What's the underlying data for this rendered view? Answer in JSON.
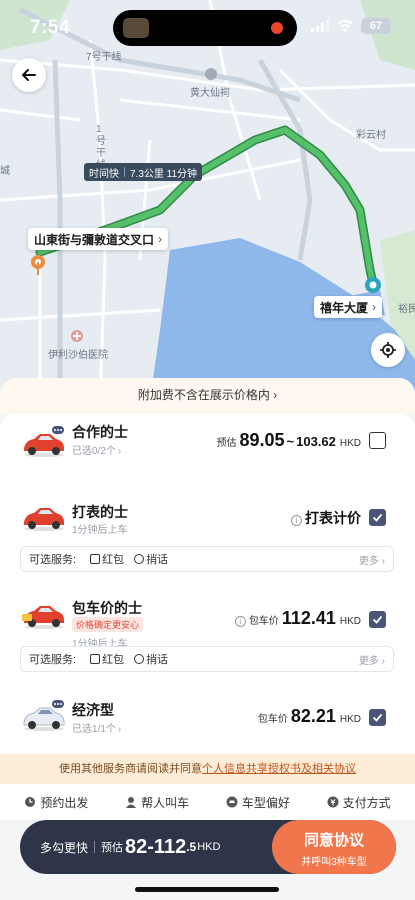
{
  "status_bar": {
    "time": "7:54",
    "battery": "67"
  },
  "map": {
    "route_label": {
      "mode": "时间快",
      "distance_duration": "7.3公里 11分钟"
    },
    "start_label": "山東街与彌敦道交叉口",
    "end_label": "禧年大厦",
    "place_names": [
      "7号干线",
      "黄大仙祠",
      "1号干线",
      "彩云村",
      "伊利沙伯医院",
      "裕民",
      "城"
    ]
  },
  "sheet": {
    "notice": "附加费不含在展示价格内",
    "options": [
      {
        "name": "合作的士",
        "sub": "已选0/2个",
        "price_prefix": "预估",
        "price_low": "89.05",
        "price_high": "103.62",
        "unit": "HKD",
        "checked": false
      },
      {
        "name": "打表的士",
        "sub": "1分钟后上车",
        "price_text": "打表计价",
        "checked": true
      },
      {
        "name": "包车价的士",
        "badge": "价格确定更安心",
        "sub": "1分钟后上车",
        "price_prefix": "包车价",
        "price": "112.41",
        "unit": "HKD",
        "checked": true
      },
      {
        "name": "经济型",
        "sub": "已选1/1个",
        "price_prefix": "包车价",
        "price": "82.21",
        "unit": "HKD",
        "checked": true
      }
    ],
    "services": {
      "label": "可选服务:",
      "option1": "红包",
      "option2": "捎话",
      "more": "更多"
    },
    "agreement": {
      "prefix": "使用其他服务商请阅读并同意",
      "link": "个人信息共享授权书及相关协议"
    },
    "toolbar": [
      "预约出发",
      "帮人叫车",
      "车型偏好",
      "支付方式"
    ],
    "cta": {
      "left_text": "多勾更快",
      "estimate_label": "预估",
      "price_main": "82-112",
      "price_decimal": ".5",
      "currency": "HKD",
      "button_title": "同意协议",
      "button_sub": "并呼叫3种车型"
    }
  },
  "colors": {
    "route": "#43b05c",
    "accent": "#f2764c",
    "check": "#4a5478",
    "dark_bar": "#2f3548"
  }
}
